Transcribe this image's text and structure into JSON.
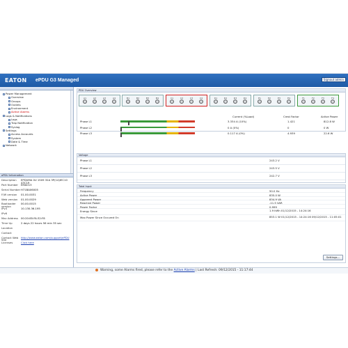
{
  "header": {
    "logo": "EATON",
    "title": "ePDU G3 Managed",
    "sign_out": "Signout admin"
  },
  "nav": {
    "items": [
      {
        "label": "Power Management",
        "indent": 0
      },
      {
        "label": "Overview",
        "indent": 1
      },
      {
        "label": "Groups",
        "indent": 1
      },
      {
        "label": "Outlets",
        "indent": 1
      },
      {
        "label": "Environment",
        "indent": 1
      },
      {
        "label": "Active Alarms",
        "indent": 1,
        "alarm": true
      },
      {
        "label": "Logs & Notifications",
        "indent": 0
      },
      {
        "label": "Logs",
        "indent": 1
      },
      {
        "label": "Trap Notification",
        "indent": 1
      },
      {
        "label": "Syslog",
        "indent": 1
      },
      {
        "label": "Settings",
        "indent": 0
      },
      {
        "label": "Access Accounts",
        "indent": 1
      },
      {
        "label": "System",
        "indent": 1
      },
      {
        "label": "Date & Time",
        "indent": 1
      },
      {
        "label": "Network",
        "indent": 0
      }
    ]
  },
  "info": {
    "title": "ePDU Information",
    "rows": [
      {
        "k": "Description",
        "v": "EPDUMA 0U 1509 32A 3P(14)IEC10 43C19"
      },
      {
        "k": "Part Number",
        "v": "EMA013"
      },
      {
        "k": "Serial Number",
        "v": "H71BA06005"
      },
      {
        "k": "F/W version",
        "v": "01.00.0031"
      },
      {
        "k": "Web version",
        "v": "01.00.0029"
      },
      {
        "k": "Bootloader version",
        "v": "00.00.0015"
      },
      {
        "k": "IPv4",
        "v": "10.130.36.195"
      },
      {
        "k": "IPv6",
        "v": ""
      },
      {
        "k": "Mac Address",
        "v": "00:20:85:FA:32:F8"
      },
      {
        "k": "Time Up",
        "v": "2 days 22 hours 56 min 35 sec"
      },
      {
        "k": "Location",
        "v": ""
      },
      {
        "k": "Contact",
        "v": ""
      },
      {
        "k": "Contact Web Site",
        "v": "http://www.eaton.com/support/ePDU",
        "link": true
      },
      {
        "k": "Licenses",
        "v": "Click here",
        "link": true
      }
    ]
  },
  "overview": {
    "title": "PDU Overview",
    "groups": [
      {
        "outlets": [
          "A1",
          "A2",
          "A3",
          "A4"
        ],
        "status": "normal"
      },
      {
        "outlets": [
          "B1",
          "B2",
          "B3",
          "B4"
        ],
        "status": "normal"
      },
      {
        "outlets": [
          "C1",
          "C2",
          "C3",
          "C4"
        ],
        "status": "alarm"
      },
      {
        "outlets": [
          "D1",
          "D2",
          "D3",
          "D4"
        ],
        "status": "normal"
      },
      {
        "outlets": [
          "E1",
          "E2",
          "E3",
          "E4"
        ],
        "status": "normal"
      },
      {
        "outlets": [
          "F1",
          "F2",
          "F3",
          "F4"
        ],
        "status": "ok"
      }
    ],
    "phase_headers": {
      "current": "Current (%Load)",
      "crest": "Crest Factor",
      "active": "Active Power"
    },
    "phases": [
      {
        "name": "Phase L1",
        "current": "3.334 A (10%)",
        "crest": "1.421",
        "active": "812.8 W",
        "load_fraction": 0.1
      },
      {
        "name": "Phase L2",
        "current": "0 A (0%)",
        "crest": "0",
        "active": "0 W",
        "load_fraction": 0.0
      },
      {
        "name": "Phase L3",
        "current": "0.117 A (0%)",
        "crest": "4.939",
        "active": "22.6 W",
        "load_fraction": 0.0
      }
    ],
    "bar_colors": {
      "green": "#3a9a3a",
      "yellow": "#e6b400",
      "red": "#d23b2a"
    }
  },
  "voltage": {
    "title": "Voltage",
    "rows": [
      {
        "k": "Phase L1",
        "v": "243.2 V"
      },
      {
        "k": "Phase L2",
        "v": "243.5 V"
      },
      {
        "k": "Phase L3",
        "v": "242.7 V"
      }
    ]
  },
  "total": {
    "title": "Total Input",
    "rows": [
      {
        "k": "Frequency",
        "v": "50.0 Hz"
      },
      {
        "k": "Active Power",
        "v": "835.0 W"
      },
      {
        "k": "Apparent Power",
        "v": "834.9 VA"
      },
      {
        "k": "Reactive Power",
        "v": "-11.5 VAR"
      },
      {
        "k": "Power Factor",
        "v": "0.999"
      },
      {
        "k": "Energy Since",
        "v": "1.9 kWh 01/12/2015 - 14:24:16",
        "tall": true
      },
      {
        "k": "Max Power Since Occured On",
        "v": "853.1 W 01/12/2015 - 14:24:16 09/12/2015 - 11:05:01",
        "tall": true
      }
    ]
  },
  "settings_button": "Settings...",
  "status": {
    "prefix": "Warning, some Alarms fired, please refer to the",
    "link": "Active Alarms",
    "suffix": "| Last Refresh: 09/12/2015 - 11:17:44"
  }
}
